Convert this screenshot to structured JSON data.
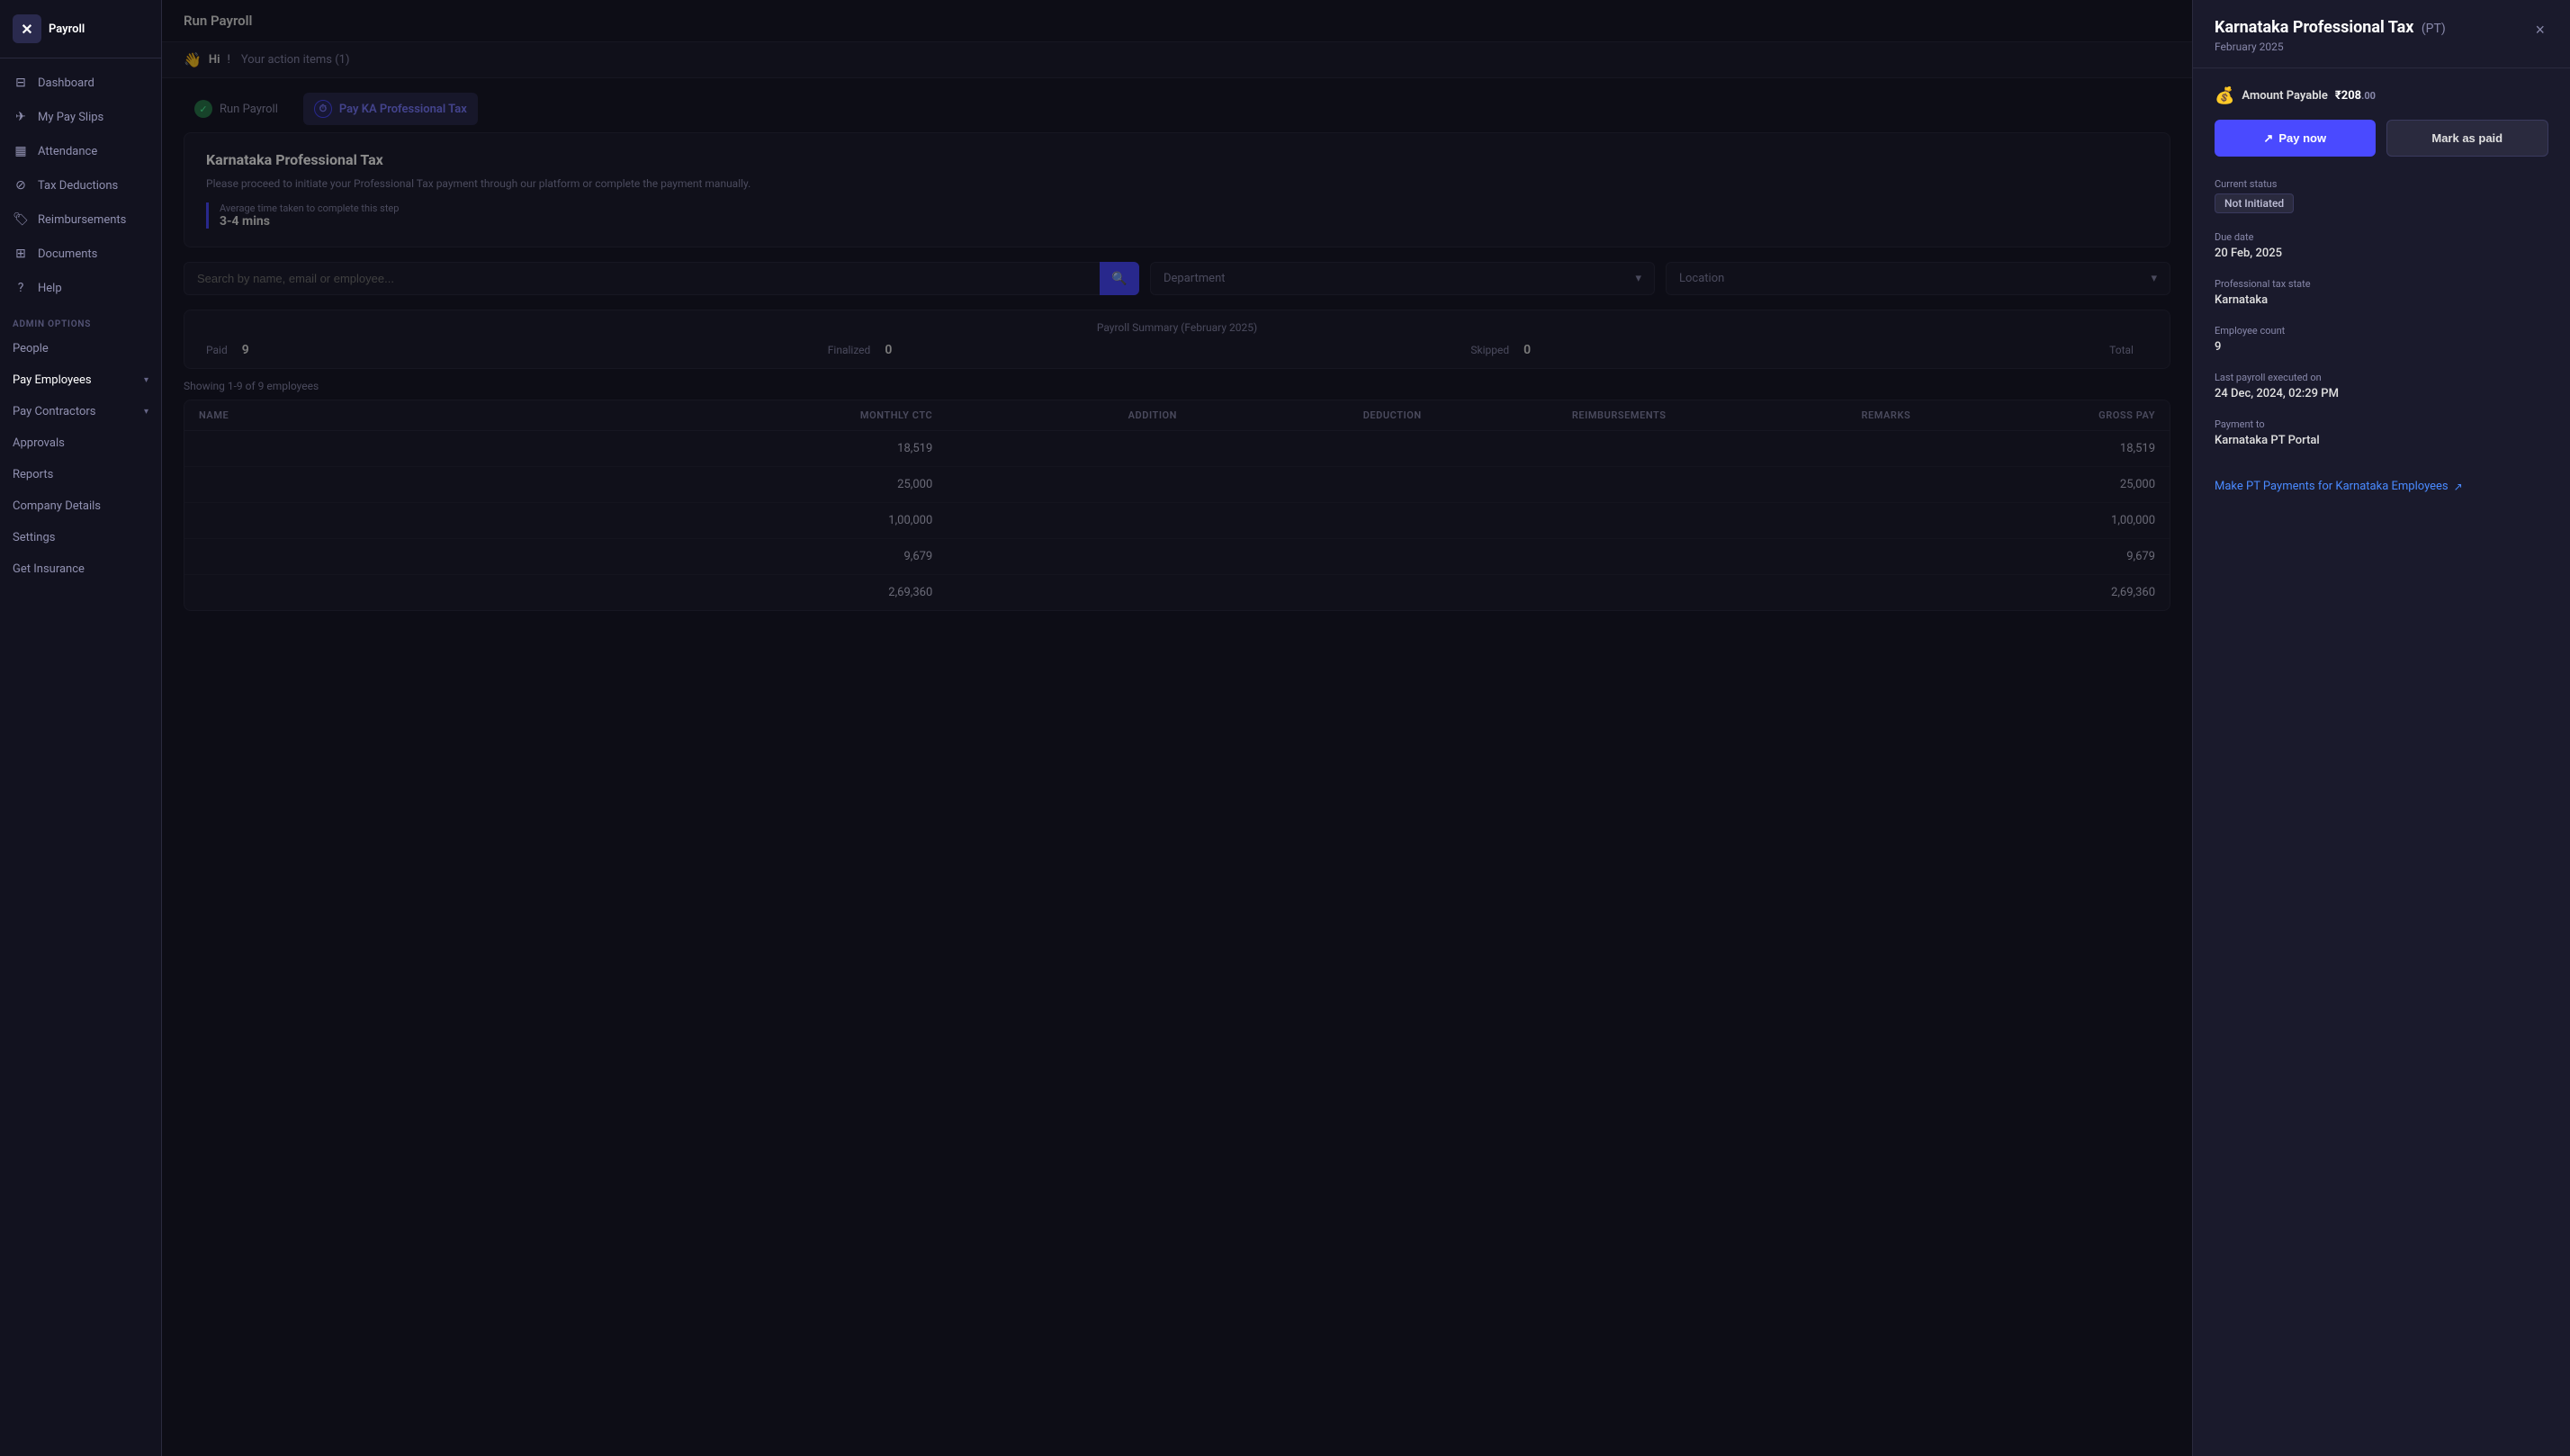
{
  "sidebar": {
    "logo": {
      "icon": "✕",
      "text": "Payroll"
    },
    "main_nav": [
      {
        "id": "dashboard",
        "label": "Dashboard",
        "icon": "⊟"
      },
      {
        "id": "my-pay-slips",
        "label": "My Pay Slips",
        "icon": "✈"
      },
      {
        "id": "attendance",
        "label": "Attendance",
        "icon": "📅"
      },
      {
        "id": "tax-deductions",
        "label": "Tax Deductions",
        "icon": "⊘"
      },
      {
        "id": "reimbursements",
        "label": "Reimbursements",
        "icon": "🏷"
      },
      {
        "id": "documents",
        "label": "Documents",
        "icon": "⊞"
      },
      {
        "id": "help",
        "label": "Help",
        "icon": "?"
      }
    ],
    "admin_section_label": "ADMIN OPTIONS",
    "admin_nav": [
      {
        "id": "people",
        "label": "People",
        "icon": "",
        "has_chevron": false
      },
      {
        "id": "pay-employees",
        "label": "Pay Employees",
        "icon": "",
        "has_chevron": true
      },
      {
        "id": "pay-contractors",
        "label": "Pay Contractors",
        "icon": "",
        "has_chevron": true
      },
      {
        "id": "approvals",
        "label": "Approvals",
        "icon": "",
        "has_chevron": false
      },
      {
        "id": "reports",
        "label": "Reports",
        "icon": "",
        "has_chevron": false
      },
      {
        "id": "company-details",
        "label": "Company Details",
        "icon": "",
        "has_chevron": false
      },
      {
        "id": "settings",
        "label": "Settings",
        "icon": "",
        "has_chevron": false
      },
      {
        "id": "get-insurance",
        "label": "Get Insurance",
        "icon": "",
        "has_chevron": false
      }
    ]
  },
  "main": {
    "header": "Run Payroll",
    "action_banner": {
      "icon": "👋",
      "greeting": "Hi",
      "separator": "!",
      "text": "Your action items (1)"
    },
    "steps": [
      {
        "id": "run-payroll",
        "label": "Run Payroll",
        "icon_type": "check"
      },
      {
        "id": "pay-ka-professional-tax",
        "label": "Pay KA Professional Tax",
        "icon_type": "clock",
        "active": true
      }
    ],
    "kt_section": {
      "title": "Karnataka Professional Tax",
      "description": "Please proceed to initiate your Professional Tax payment through our platform or complete the payment manually.",
      "time_label": "Average time taken to complete this step",
      "time_value": "3-4 mins"
    },
    "search_placeholder": "Search by name, email or employee...",
    "department_placeholder": "Department",
    "location_placeholder": "Location",
    "summary": {
      "title": "Payroll Summary (February 2025)",
      "stats": [
        {
          "label": "Paid",
          "value": "9"
        },
        {
          "label": "Finalized",
          "value": "0"
        },
        {
          "label": "Skipped",
          "value": "0"
        },
        {
          "label": "Total",
          "value": ""
        }
      ]
    },
    "employees_count": "Showing 1-9 of 9 employees",
    "table": {
      "headers": [
        "Name",
        "Monthly CTC",
        "Addition",
        "Deduction",
        "Reimbursements",
        "Remarks",
        "Gross Pay"
      ],
      "rows": [
        {
          "name": "",
          "monthly_ctc": "18,519",
          "addition": "",
          "deduction": "",
          "reimbursements": "",
          "remarks": "",
          "gross_pay": "18,519"
        },
        {
          "name": "",
          "monthly_ctc": "25,000",
          "addition": "",
          "deduction": "",
          "reimbursements": "",
          "remarks": "",
          "gross_pay": "25,000"
        },
        {
          "name": "",
          "monthly_ctc": "1,00,000",
          "addition": "",
          "deduction": "",
          "reimbursements": "",
          "remarks": "",
          "gross_pay": "1,00,000"
        },
        {
          "name": "",
          "monthly_ctc": "9,679",
          "addition": "",
          "deduction": "",
          "reimbursements": "",
          "remarks": "",
          "gross_pay": "9,679"
        },
        {
          "name": "",
          "monthly_ctc": "2,69,360",
          "addition": "",
          "deduction": "",
          "reimbursements": "",
          "remarks": "",
          "gross_pay": "2,69,360"
        }
      ]
    }
  },
  "panel": {
    "title": "Karnataka Professional Tax",
    "pt_label": "(PT)",
    "subtitle": "February 2025",
    "close_label": "×",
    "amount": {
      "icon": "💰",
      "label": "Amount Payable",
      "currency_symbol": "₹",
      "integer": "208",
      "decimal": ".00"
    },
    "buttons": {
      "pay_now": "Pay now",
      "pay_now_icon": "↗",
      "mark_as_paid": "Mark as paid"
    },
    "info": {
      "current_status_label": "Current status",
      "current_status_value": "Not Initiated",
      "due_date_label": "Due date",
      "due_date_value": "20 Feb, 2025",
      "professional_tax_state_label": "Professional tax state",
      "professional_tax_state_value": "Karnataka",
      "employee_count_label": "Employee count",
      "employee_count_value": "9",
      "last_payroll_label": "Last payroll executed on",
      "last_payroll_value": "24 Dec, 2024, 02:29 PM",
      "payment_to_label": "Payment to",
      "payment_to_value": "Karnataka PT Portal"
    },
    "link": {
      "text": "Make PT Payments for Karnataka Employees",
      "icon": "↗"
    }
  }
}
